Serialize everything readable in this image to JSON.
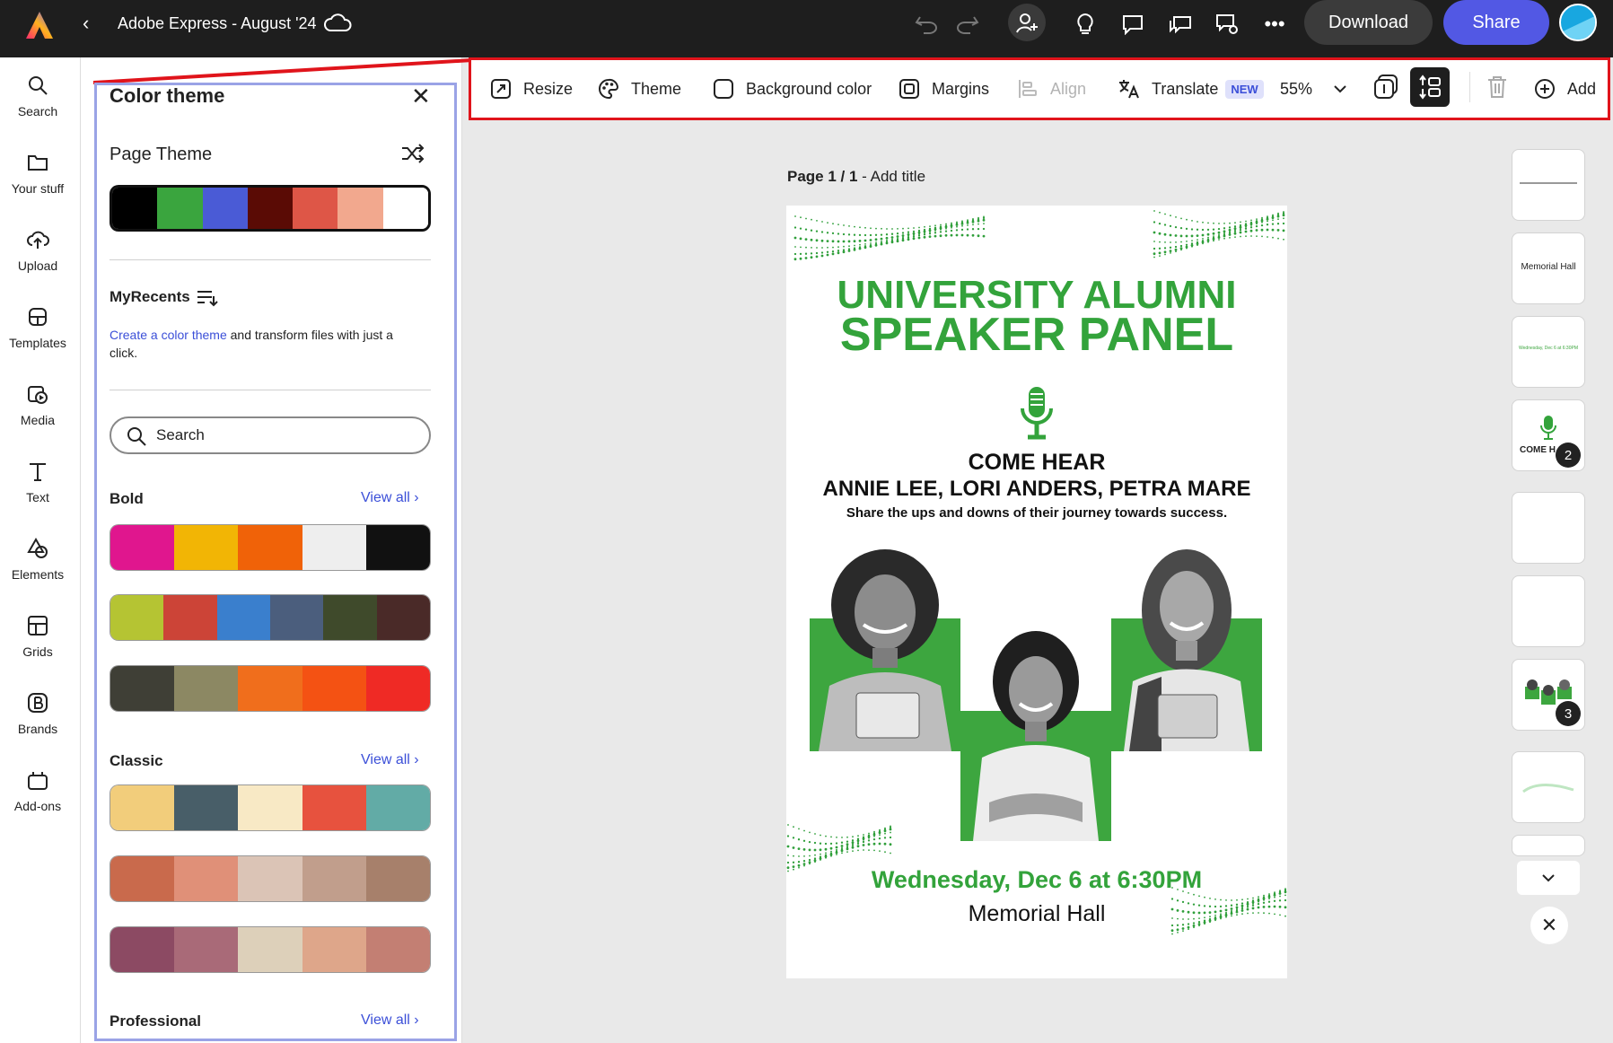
{
  "app": {
    "title": "Adobe Express - August '24",
    "download_label": "Download",
    "share_label": "Share",
    "accent": "#5258e4"
  },
  "rail": {
    "items": [
      {
        "label": "Search",
        "icon": "search-icon"
      },
      {
        "label": "Your stuff",
        "icon": "folder-icon"
      },
      {
        "label": "Upload",
        "icon": "upload-icon"
      },
      {
        "label": "Templates",
        "icon": "templates-icon"
      },
      {
        "label": "Media",
        "icon": "media-icon"
      },
      {
        "label": "Text",
        "icon": "text-icon"
      },
      {
        "label": "Elements",
        "icon": "elements-icon"
      },
      {
        "label": "Grids",
        "icon": "grids-icon"
      },
      {
        "label": "Brands",
        "icon": "brands-icon"
      },
      {
        "label": "Add-ons",
        "icon": "add-ons-icon"
      }
    ]
  },
  "panel": {
    "title": "Color theme",
    "page_theme_label": "Page Theme",
    "page_theme_colors": [
      "#000000",
      "#3aa53e",
      "#4a5bd6",
      "#5a0b05",
      "#de5647",
      "#f2a88e",
      "#ffffff"
    ],
    "recents_label": "MyRecents",
    "recents_link": "Create a color theme",
    "recents_text": " and transform files with just a click.",
    "search_placeholder": "Search",
    "bold_label": "Bold",
    "classic_label": "Classic",
    "professional_label": "Professional",
    "view_all": "View all",
    "bold_themes": [
      [
        "#e0168e",
        "#f2b505",
        "#f06208",
        "#eeeeee",
        "#111111"
      ],
      [
        "#b5c433",
        "#cc4437",
        "#3a7fcd",
        "#4b5e7d",
        "#3f4a2b",
        "#4a2a28"
      ],
      [
        "#3f3f36",
        "#8c8863",
        "#f06e1c",
        "#f45213",
        "#ef2a25"
      ]
    ],
    "classic_themes": [
      [
        "#f2cd7b",
        "#485e68",
        "#f8e9c5",
        "#e7523e",
        "#62aba6"
      ],
      [
        "#c96a4c",
        "#e09078",
        "#dbc4b6",
        "#c19e8c",
        "#a7806b"
      ],
      [
        "#8c4a63",
        "#a96a78",
        "#ddd0ba",
        "#dea68a",
        "#c37f73"
      ]
    ]
  },
  "toolbar": {
    "resize": "Resize",
    "theme": "Theme",
    "background_color": "Background color",
    "margins": "Margins",
    "align": "Align",
    "translate": "Translate",
    "new_badge": "NEW",
    "zoom": "55%",
    "add": "Add"
  },
  "canvas": {
    "page_label_bold": "Page 1 / 1",
    "page_label_rest": " - Add title",
    "headline_1": "UNIVERSITY ALUMNI",
    "headline_2": "SPEAKER PANEL",
    "come_hear": "COME HEAR",
    "speakers": "ANNIE LEE, LORI ANDERS, PETRA MARE",
    "tagline": "Share the ups and downs of their journey towards success.",
    "date": "Wednesday, Dec 6 at 6:30PM",
    "venue": "Memorial Hall",
    "accent": "#3da63f"
  },
  "thumbnails": {
    "items": [
      {
        "text": ""
      },
      {
        "text": "Memorial Hall"
      },
      {
        "text": "Wednesday, Dec 6 at 6:30PM"
      },
      {
        "text": "COME H",
        "badge": "2"
      },
      {
        "text": ""
      },
      {
        "text": ""
      },
      {
        "text": "",
        "badge": "3"
      },
      {
        "text": ""
      }
    ]
  }
}
